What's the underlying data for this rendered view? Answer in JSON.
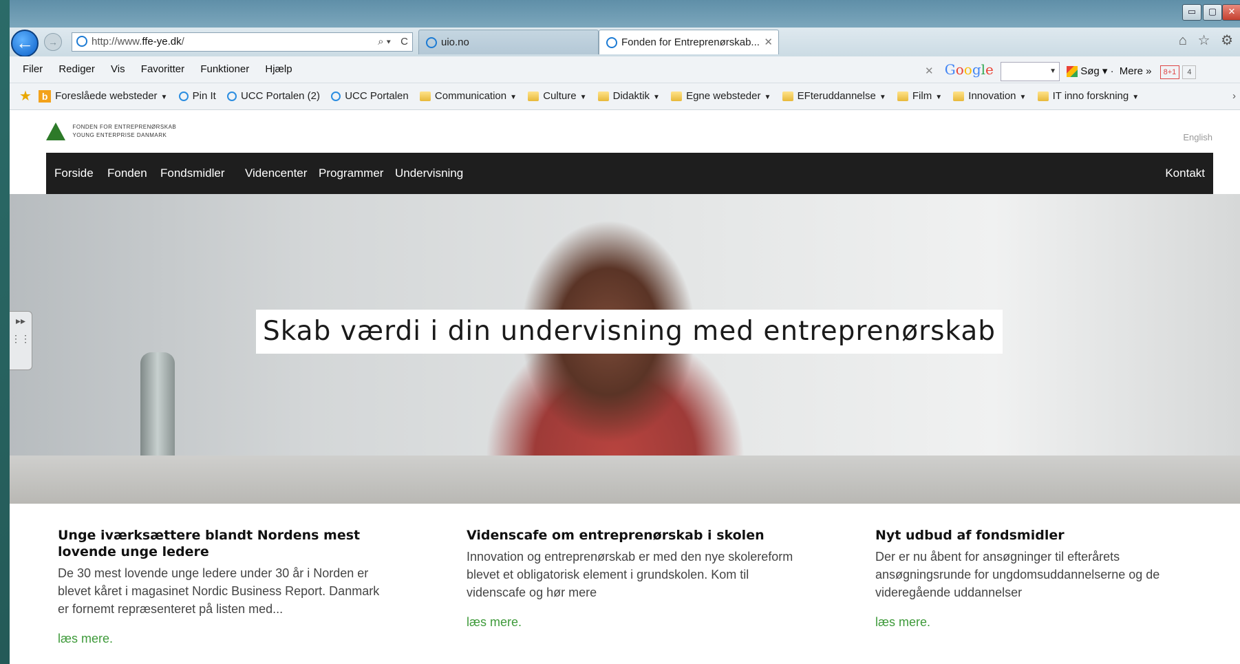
{
  "browser": {
    "nav": {
      "back_icon": "back-arrow-icon",
      "forward_icon": "forward-arrow-icon"
    },
    "address": {
      "url_prefix": "http://www.",
      "url_domain": "ffe-ye.dk",
      "url_suffix": "/",
      "search_glyph": "⌕ ▾",
      "refresh_glyph": "C"
    },
    "tabs": [
      {
        "label": "uio.no"
      },
      {
        "label": "Fonden for Entreprenørskab...",
        "close": "✕"
      }
    ],
    "window_controls": {
      "minimize": "▭",
      "maximize": "▢",
      "close": "✕"
    },
    "right_icons": {
      "home": "⌂",
      "favorites": "☆",
      "settings": "⚙"
    },
    "menu": [
      "Filer",
      "Rediger",
      "Vis",
      "Favoritter",
      "Funktioner",
      "Hjælp"
    ],
    "google_toolbar": {
      "close": "✕",
      "logo": "Google",
      "search_label": "Søg",
      "more_label": "Mere »",
      "gplus": "8+1",
      "count": "4"
    },
    "favorites": [
      {
        "label": "Foreslåede websteder",
        "icon": "bing",
        "dropdown": true
      },
      {
        "label": "Pin It",
        "icon": "ie",
        "dropdown": false
      },
      {
        "label": "UCC Portalen (2)",
        "icon": "ie",
        "dropdown": false
      },
      {
        "label": "UCC Portalen",
        "icon": "ie",
        "dropdown": false
      },
      {
        "label": "Communication",
        "icon": "folder",
        "dropdown": true
      },
      {
        "label": "Culture",
        "icon": "folder",
        "dropdown": true
      },
      {
        "label": "Didaktik",
        "icon": "folder",
        "dropdown": true
      },
      {
        "label": "Egne websteder",
        "icon": "folder",
        "dropdown": true
      },
      {
        "label": "EFteruddannelse",
        "icon": "folder",
        "dropdown": true
      },
      {
        "label": "Film",
        "icon": "folder",
        "dropdown": true
      },
      {
        "label": "Innovation",
        "icon": "folder",
        "dropdown": true
      },
      {
        "label": "IT inno forskning",
        "icon": "folder",
        "dropdown": true
      }
    ],
    "favorites_more": "›"
  },
  "site": {
    "logo_line1": "FONDEN FOR ENTREPRENØRSKAB",
    "logo_line2": "YOUNG ENTERPRISE DANMARK",
    "language_link": "English",
    "nav": [
      "Forside",
      "Fonden",
      "Fondsmidler",
      "Videncenter",
      "Programmer",
      "Undervisning"
    ],
    "nav_right": "Kontakt",
    "hero_headline": "Skab værdi i din undervisning med entreprenørskab",
    "sidetab_glyph": "▸▸",
    "columns": [
      {
        "title": "Unge iværksættere blandt Nordens mest lovende unge ledere",
        "body": "De 30 mest lovende unge ledere under 30 år i Norden er blevet kåret i magasinet Nordic Business Report. Danmark er fornemt repræsenteret på listen med...",
        "link": "læs mere."
      },
      {
        "title": "Videnscafe om entreprenørskab i skolen",
        "body": "Innovation og entreprenørskab er med den nye skolereform blevet et obligatorisk element i grundskolen. Kom til videnscafe og hør mere",
        "link": "læs mere."
      },
      {
        "title": "Nyt udbud af fondsmidler",
        "body": "Der er nu åbent for ansøgninger til efterårets ansøgningsrunde for ungdomsuddannelserne og de videregående uddannelser",
        "link": "læs mere."
      }
    ]
  }
}
